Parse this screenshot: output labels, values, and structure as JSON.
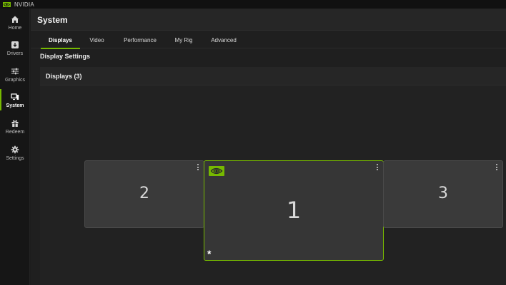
{
  "app": {
    "title": "NVIDIA"
  },
  "sidebar": {
    "items": [
      {
        "label": "Home",
        "icon": "home-icon"
      },
      {
        "label": "Drivers",
        "icon": "download-icon"
      },
      {
        "label": "Graphics",
        "icon": "sliders-icon"
      },
      {
        "label": "System",
        "icon": "monitor-icon",
        "active": true
      },
      {
        "label": "Redeem",
        "icon": "gift-icon"
      },
      {
        "label": "Settings",
        "icon": "gear-icon"
      }
    ]
  },
  "page": {
    "title": "System"
  },
  "tabs": [
    {
      "label": "Displays",
      "active": true
    },
    {
      "label": "Video"
    },
    {
      "label": "Performance"
    },
    {
      "label": "My Rig"
    },
    {
      "label": "Advanced"
    }
  ],
  "display_settings": {
    "heading": "Display Settings",
    "panel_title": "Displays (3)",
    "monitors": [
      {
        "number": "2",
        "primary": false
      },
      {
        "number": "1",
        "primary": true,
        "marker": "*"
      },
      {
        "number": "3",
        "primary": false
      }
    ]
  },
  "colors": {
    "accent": "#76b900",
    "background": "#1f1f1f",
    "sidebar": "#161616",
    "monitor": "#3a3a3a"
  }
}
